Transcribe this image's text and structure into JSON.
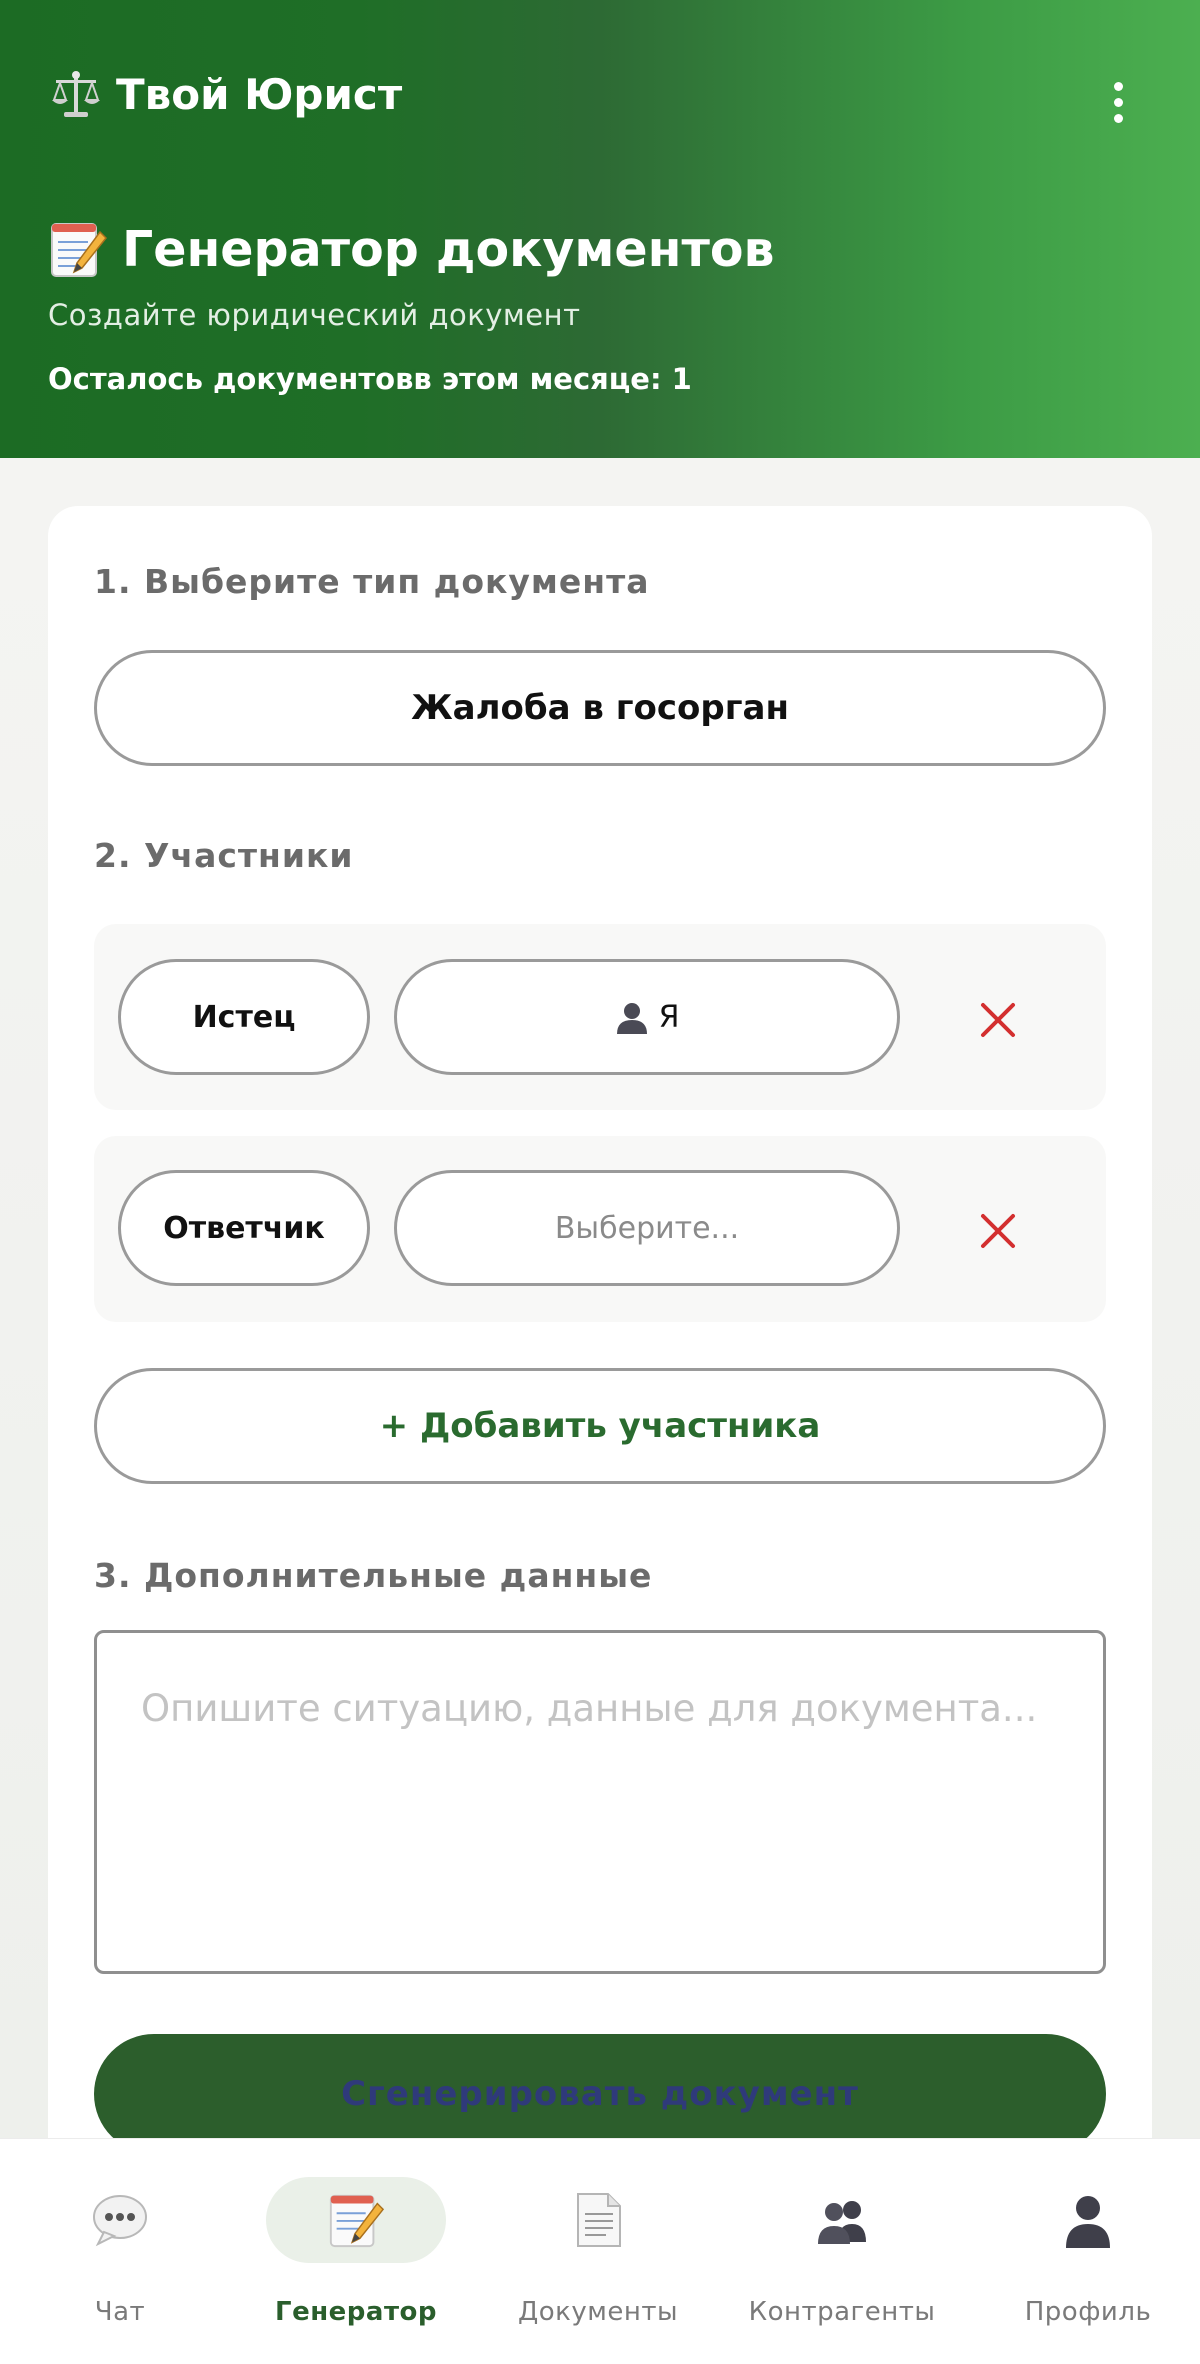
{
  "header": {
    "app_title": "Твой Юрист",
    "app_icon": "balance-scale-icon",
    "menu_icon": "more-vertical-icon",
    "page_title": "Генератор документов",
    "page_icon": "memo-icon",
    "subtitle": "Создайте юридический документ",
    "docs_left": "Осталось документовв этом месяце: 1"
  },
  "form": {
    "section1_label": "1. Выберите тип документа",
    "document_type": "Жалоба в госорган",
    "section2_label": "2. Участники",
    "participants": [
      {
        "role": "Истец",
        "person": "Я",
        "person_icon": "bust-icon",
        "remove_icon": "close-icon"
      },
      {
        "role": "Ответчик",
        "person": "Выберите...",
        "remove_icon": "close-icon"
      }
    ],
    "add_participant_label": "+ Добавить участника",
    "section3_label": "3. Дополнительные данные",
    "details_placeholder": "Опишите ситуацию, данные для документа...",
    "details_value": "",
    "generate_label": "Сгенерировать документ"
  },
  "nav": {
    "items": [
      {
        "label": "Чат",
        "icon": "speech-bubble-icon",
        "active": false
      },
      {
        "label": "Генератор",
        "icon": "memo-icon",
        "active": true
      },
      {
        "label": "Документы",
        "icon": "document-icon",
        "active": false
      },
      {
        "label": "Контрагенты",
        "icon": "people-icon",
        "active": false
      },
      {
        "label": "Профиль",
        "icon": "user-icon",
        "active": false
      }
    ]
  },
  "colors": {
    "header_start": "#1c6b24",
    "header_end": "#4caf50",
    "primary_dark": "#2c5e2c",
    "remove_red": "#d32f2f",
    "active_nav_bg": "#eaf0e8"
  }
}
